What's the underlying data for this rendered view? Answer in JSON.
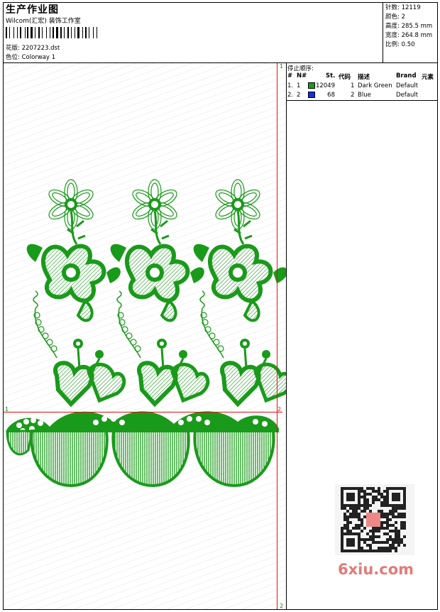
{
  "header": {
    "title": "生产作业图",
    "company": "Wilcom(汇宏) 装饰工作室",
    "design_label": "花版: 2207223.dst",
    "colorway_label": "色位: Colorway 1"
  },
  "stats": [
    {
      "label": "针数:",
      "value": "12119"
    },
    {
      "label": "颜色:",
      "value": "2"
    },
    {
      "label": "高度:",
      "value": "285.5 mm"
    },
    {
      "label": "宽度:",
      "value": "264.8 mm"
    },
    {
      "label": "比例:",
      "value": "0.50"
    }
  ],
  "stop_sequence": {
    "title": "停止顺序:",
    "columns": [
      "#",
      "N#",
      "St.",
      "代码",
      "描述",
      "Brand",
      "元素"
    ],
    "rows": [
      {
        "idx": "1.",
        "n": "1",
        "color": "#1a9a1a",
        "stitches": "12049",
        "code": "1",
        "desc": "Dark Green",
        "brand": "Default"
      },
      {
        "idx": "2.",
        "n": "2",
        "color": "#1030e0",
        "stitches": "68",
        "code": "2",
        "desc": "Blue",
        "brand": "Default"
      }
    ]
  },
  "markers": {
    "top_right": "1",
    "bottom_right": "2",
    "left": "1",
    "right_cross": "2"
  },
  "embroidery_color": "#1a9a1a",
  "guide_color": "#dd1111",
  "watermark": "6xiu.com"
}
